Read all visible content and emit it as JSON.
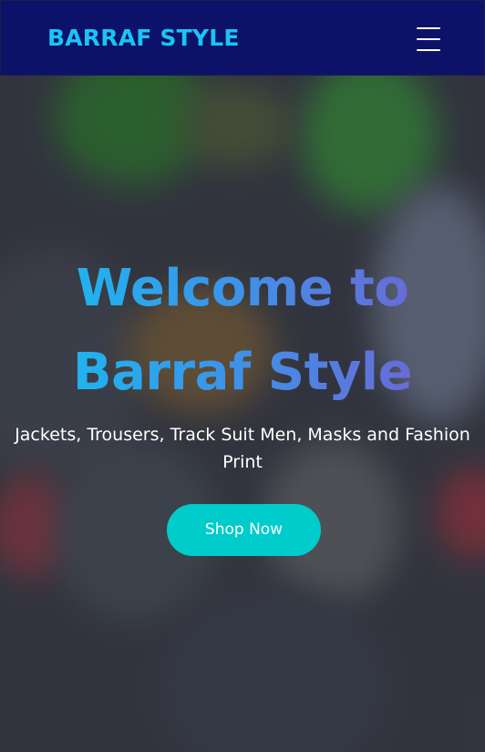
{
  "header": {
    "brand": "BARRAF STYLE",
    "menu_icon": "hamburger-menu-icon"
  },
  "hero": {
    "title": "Welcome to\nBarraf Style",
    "subtitle": "Jackets, Trousers, Track Suit Men, Masks and Fashion\nPrint",
    "cta_label": "Shop Now"
  },
  "colors": {
    "header_bg": "#0c1268",
    "brand": "#18c5f5",
    "cta_bg": "#00cccc",
    "title_gradient_start": "#12c2f0",
    "title_gradient_end": "#7a5bd0"
  }
}
